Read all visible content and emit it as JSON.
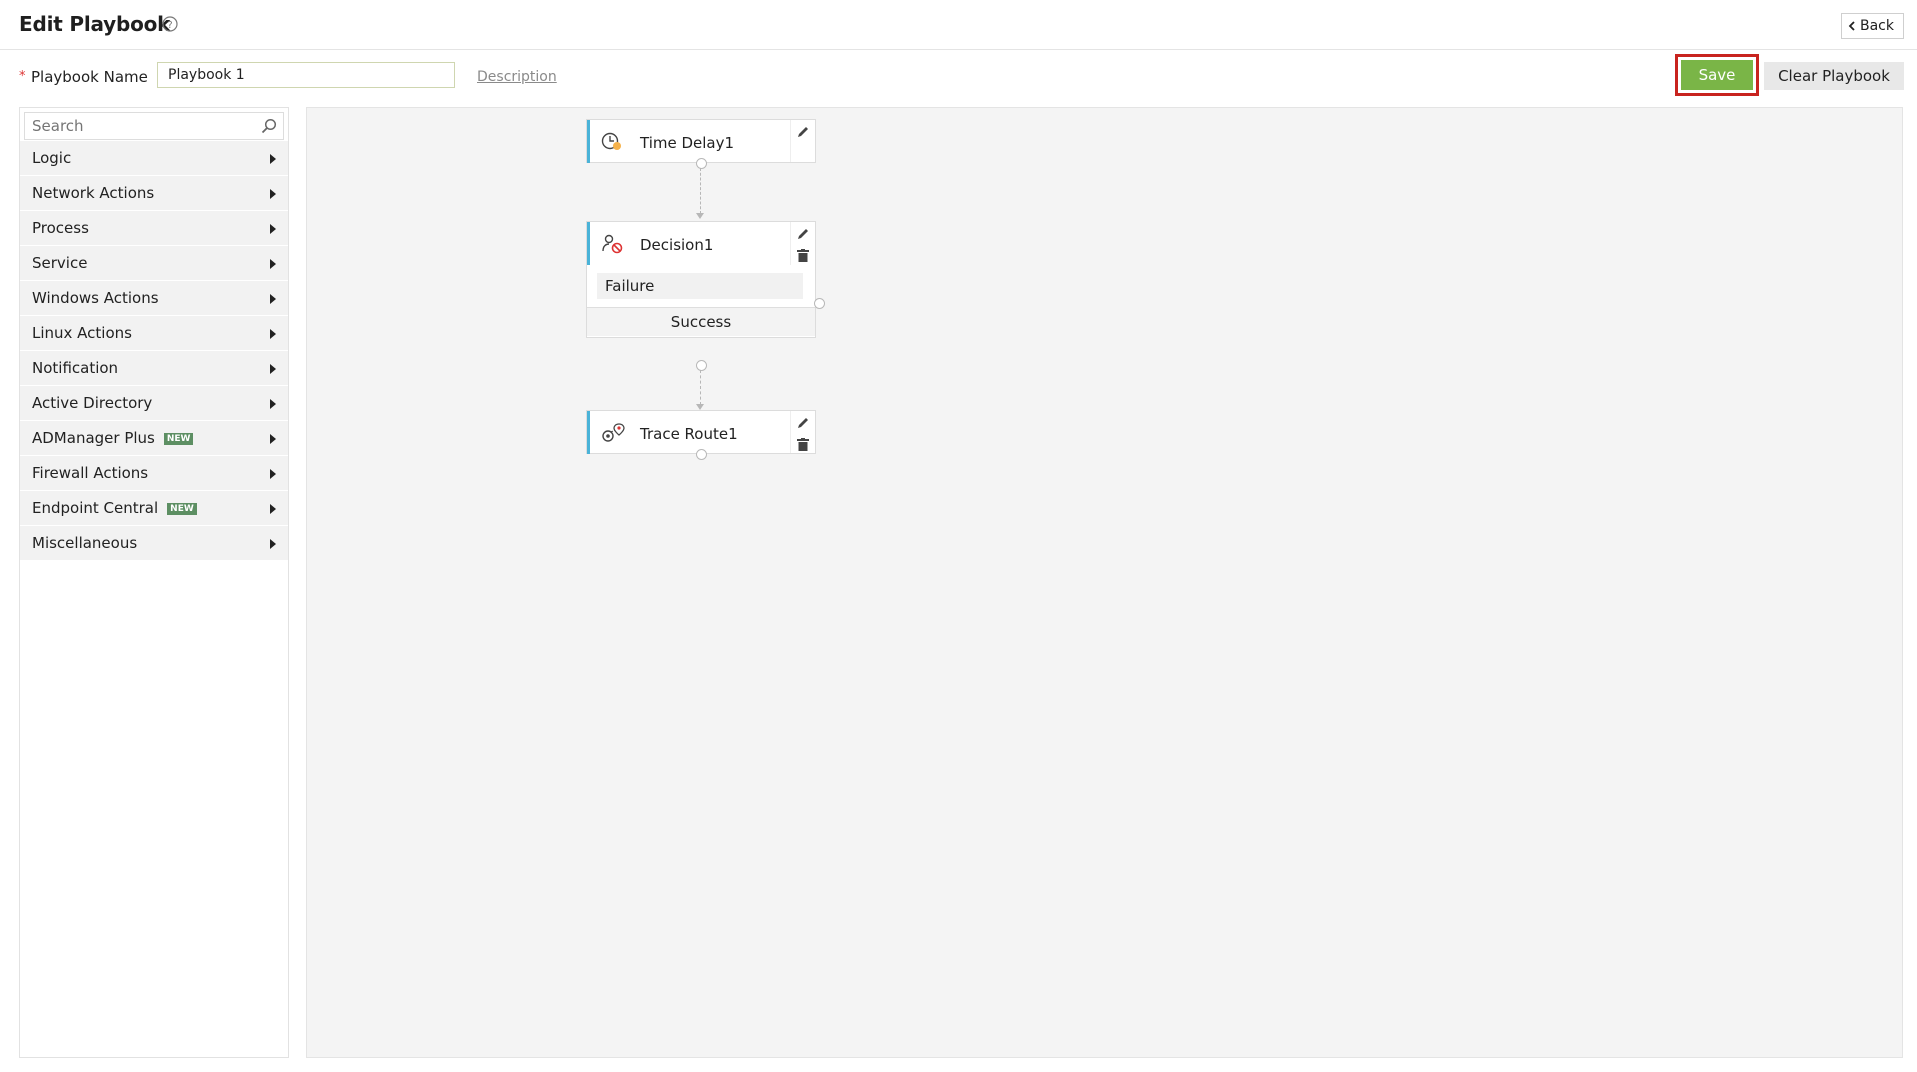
{
  "header": {
    "title": "Edit Playbook",
    "back_label": "Back"
  },
  "form": {
    "name_label": "Playbook Name",
    "required_marker": "*",
    "name_value": "Playbook 1",
    "description_link": "Description",
    "save_label": "Save",
    "clear_label": "Clear Playbook"
  },
  "sidebar": {
    "search_placeholder": "Search",
    "items": [
      {
        "label": "Logic",
        "badge": ""
      },
      {
        "label": "Network Actions",
        "badge": ""
      },
      {
        "label": "Process",
        "badge": ""
      },
      {
        "label": "Service",
        "badge": ""
      },
      {
        "label": "Windows Actions",
        "badge": ""
      },
      {
        "label": "Linux Actions",
        "badge": ""
      },
      {
        "label": "Notification",
        "badge": ""
      },
      {
        "label": "Active Directory",
        "badge": ""
      },
      {
        "label": "ADManager Plus",
        "badge": "NEW"
      },
      {
        "label": "Firewall Actions",
        "badge": ""
      },
      {
        "label": "Endpoint Central",
        "badge": "NEW"
      },
      {
        "label": "Miscellaneous",
        "badge": ""
      }
    ]
  },
  "canvas": {
    "nodes": [
      {
        "label": "Time Delay1",
        "icon": "clock-icon"
      },
      {
        "label": "Decision1",
        "icon": "decision-icon",
        "branch_failure": "Failure",
        "branch_success": "Success"
      },
      {
        "label": "Trace Route1",
        "icon": "trace-route-icon"
      }
    ]
  },
  "colors": {
    "accent": "#4ab3d8",
    "save": "#7ab547",
    "highlight": "#c8231f",
    "badge": "#5d8f63"
  }
}
